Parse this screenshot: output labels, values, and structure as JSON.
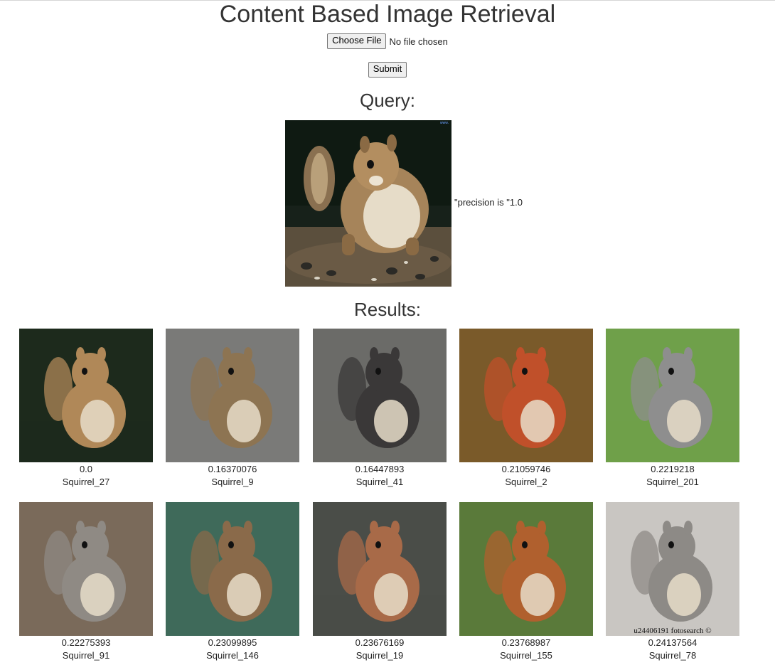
{
  "title": "Content Based Image Retrieval",
  "upload": {
    "choose_label": "Choose File",
    "status": "No file chosen"
  },
  "submit_label": "Submit",
  "query": {
    "heading": "Query:",
    "precision_text": "\"precision is \"1.0"
  },
  "results": {
    "heading": "Results:",
    "items": [
      {
        "score": "0.0",
        "label": "Squirrel_27",
        "bg": "#1d2a1c",
        "fur": "#b08858"
      },
      {
        "score": "0.16370076",
        "label": "Squirrel_9",
        "bg": "#7a7a78",
        "fur": "#8d7452"
      },
      {
        "score": "0.16447893",
        "label": "Squirrel_41",
        "bg": "#6b6b68",
        "fur": "#3a3838"
      },
      {
        "score": "0.21059746",
        "label": "Squirrel_2",
        "bg": "#7a5a2a",
        "fur": "#c0502a"
      },
      {
        "score": "0.2219218",
        "label": "Squirrel_201",
        "bg": "#6fa04a",
        "fur": "#8e8e8e"
      },
      {
        "score": "0.22275393",
        "label": "Squirrel_91",
        "bg": "#7a6a5a",
        "fur": "#8f8a84"
      },
      {
        "score": "0.23099895",
        "label": "Squirrel_146",
        "bg": "#3f6a5a",
        "fur": "#8a6a4a"
      },
      {
        "score": "0.23676169",
        "label": "Squirrel_19",
        "bg": "#4a4d48",
        "fur": "#a86a48"
      },
      {
        "score": "0.23768987",
        "label": "Squirrel_155",
        "bg": "#5a7a3a",
        "fur": "#b0602e"
      },
      {
        "score": "0.24137564",
        "label": "Squirrel_78",
        "bg": "#c9c6c2",
        "fur": "#8d8a86"
      }
    ]
  },
  "watermarks": {
    "fotosearch": "u24406191 fotosearch ©"
  }
}
